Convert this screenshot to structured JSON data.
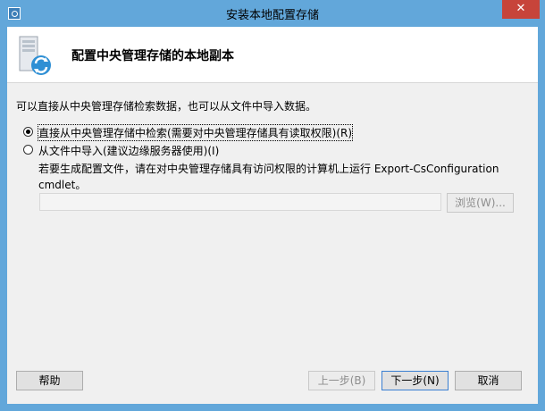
{
  "window": {
    "title": "安装本地配置存储",
    "close_label": "✕"
  },
  "header": {
    "title": "配置中央管理存储的本地副本"
  },
  "intro_text": "可以直接从中央管理存储检索数据，也可以从文件中导入数据。",
  "options": [
    {
      "label": "直接从中央管理存储中检索(需要对中央管理存储具有读取权限)(R)",
      "selected": true
    },
    {
      "label": "从文件中导入(建议边缘服务器使用)(I)",
      "selected": false
    }
  ],
  "note": "若要生成配置文件，请在对中央管理存储具有访问权限的计算机上运行 Export-CsConfiguration cmdlet。",
  "path_input": {
    "value": ""
  },
  "buttons": {
    "browse": "浏览(W)...",
    "help": "帮助",
    "back": "上一步(B)",
    "next": "下一步(N)",
    "cancel": "取消"
  },
  "icons": {
    "app": "setup-icon",
    "header": "server-refresh-icon",
    "close": "close-icon"
  }
}
